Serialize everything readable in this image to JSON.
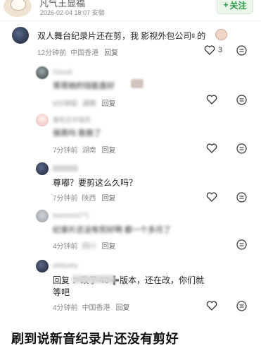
{
  "header": {
    "username": "凡气王显福",
    "date": "2026-02-04 18:07",
    "location": "安徽",
    "follow_label": "关注"
  },
  "comments": [
    {
      "text": "双人舞台纪录片还在剪，我 影视外包公司ᵍ 的",
      "meta_time": "12分钟前",
      "meta_location": "中国香港",
      "reply_label": "回复",
      "likes": "3"
    },
    {
      "username": "Ctovoli",
      "text": "哥哥她的钱能直好",
      "meta_time": "6分钟前",
      "meta_location": "湖南",
      "reply_label": "回复"
    },
    {
      "username": "爱吃北半球苏",
      "text": "保真吗 救救了",
      "meta_time": "7分钟前",
      "meta_location": "湖南",
      "reply_label": "回复"
    },
    {
      "username": "",
      "text": "尊嘟？要剪这么久吗？",
      "meta_time": "7分钟前",
      "meta_location": "陕西",
      "reply_label": "回复"
    },
    {
      "username": "buonomo7℃",
      "text": "纪录片还没有剪好啊 都一个多月了",
      "meta_time": "4分钟前",
      "meta_location": "四川",
      "reply_label": "回复"
    },
    {
      "username": "elsbushy",
      "text_line1": "回复 ：改了 40➕版本，还在改，你们就",
      "text_line2": "等吧",
      "meta_time": "4分钟前",
      "meta_location": "中国香港",
      "reply_label": "回复"
    }
  ],
  "caption": "刷到说新音纪录片还没有剪好"
}
